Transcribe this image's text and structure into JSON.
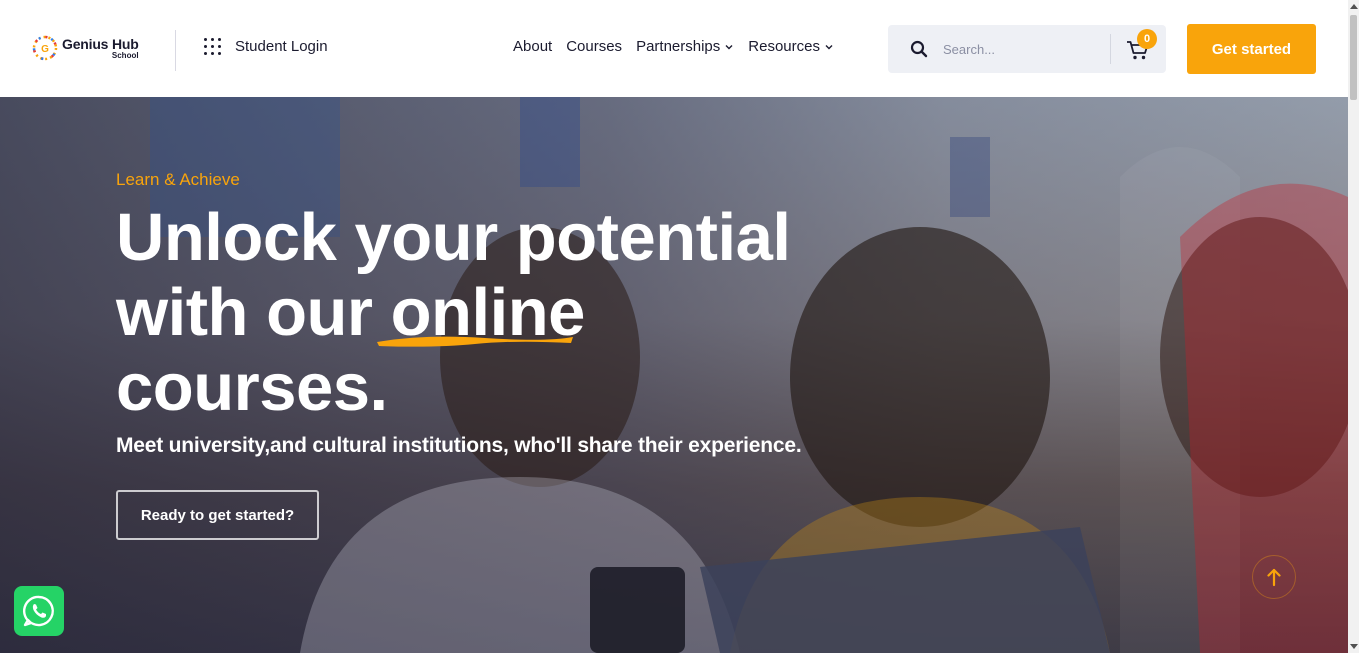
{
  "colors": {
    "accent": "#f9a40b",
    "dark": "#1b1b2f",
    "whatsapp": "#25d366"
  },
  "header": {
    "logo_title": "Genius Hub",
    "logo_subtitle": "School",
    "student_login": "Student Login",
    "nav": [
      {
        "label": "About",
        "has_dropdown": false
      },
      {
        "label": "Courses",
        "has_dropdown": false
      },
      {
        "label": "Partnerships",
        "has_dropdown": true
      },
      {
        "label": "Resources",
        "has_dropdown": true
      }
    ],
    "search_placeholder": "Search...",
    "cart_count": "0",
    "cta_label": "Get started"
  },
  "hero": {
    "eyebrow": "Learn & Achieve",
    "headline_part1": "Unlock your potential with our ",
    "headline_highlight": "online",
    "headline_part2": " courses.",
    "subtext": "Meet university,and cultural institutions, who'll share their experience.",
    "button_label": "Ready to get started?"
  },
  "icons": [
    "grid-icon",
    "chevron-down-icon",
    "search-icon",
    "cart-icon",
    "arrow-up-icon",
    "whatsapp-icon"
  ]
}
